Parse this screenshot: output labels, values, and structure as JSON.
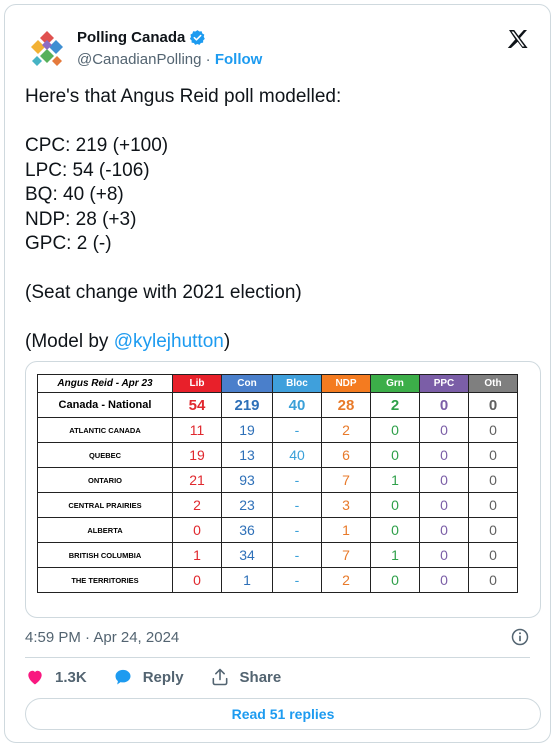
{
  "author": {
    "name": "Polling Canada",
    "handle": "@CanadianPolling",
    "separator": "·",
    "follow_label": "Follow"
  },
  "tweet": {
    "intro": "Here's that Angus Reid poll modelled:",
    "lines": [
      "CPC: 219 (+100)",
      "LPC: 54 (-106)",
      "BQ: 40 (+8)",
      "NDP: 28 (+3)",
      "GPC: 2 (-)"
    ],
    "note": "(Seat change with 2021 election)",
    "credit_prefix": "(Model by ",
    "credit_mention": "@kylejhutton",
    "credit_suffix": ")"
  },
  "seat_table": {
    "title": "Angus Reid - Apr 23",
    "parties": [
      {
        "label": "Lib",
        "header_color": "#e8202a",
        "text_color": "#e0282e"
      },
      {
        "label": "Con",
        "header_color": "#4a7fcb",
        "text_color": "#2e70b8"
      },
      {
        "label": "Bloc",
        "header_color": "#3fa0dc",
        "text_color": "#3aa0d8"
      },
      {
        "label": "NDP",
        "header_color": "#f47b20",
        "text_color": "#e87a2a"
      },
      {
        "label": "Grn",
        "header_color": "#3cae49",
        "text_color": "#2fa04a"
      },
      {
        "label": "PPC",
        "header_color": "#7b5ea7",
        "text_color": "#7b5ea7"
      },
      {
        "label": "Oth",
        "header_color": "#7f7f7f",
        "text_color": "#606060"
      }
    ],
    "rows": [
      {
        "region": "Canada - National",
        "values": [
          "54",
          "219",
          "40",
          "28",
          "2",
          "0",
          "0"
        ]
      },
      {
        "region": "ATLANTIC CANADA",
        "values": [
          "11",
          "19",
          "-",
          "2",
          "0",
          "0",
          "0"
        ]
      },
      {
        "region": "QUEBEC",
        "values": [
          "19",
          "13",
          "40",
          "6",
          "0",
          "0",
          "0"
        ]
      },
      {
        "region": "ONTARIO",
        "values": [
          "21",
          "93",
          "-",
          "7",
          "1",
          "0",
          "0"
        ]
      },
      {
        "region": "CENTRAL PRAIRIES",
        "values": [
          "2",
          "23",
          "-",
          "3",
          "0",
          "0",
          "0"
        ]
      },
      {
        "region": "ALBERTA",
        "values": [
          "0",
          "36",
          "-",
          "1",
          "0",
          "0",
          "0"
        ]
      },
      {
        "region": "BRITISH COLUMBIA",
        "values": [
          "1",
          "34",
          "-",
          "7",
          "1",
          "0",
          "0"
        ]
      },
      {
        "region": "THE TERRITORIES",
        "values": [
          "0",
          "1",
          "-",
          "2",
          "0",
          "0",
          "0"
        ]
      }
    ]
  },
  "timestamp": "4:59 PM · Apr 24, 2024",
  "actions": {
    "likes": "1.3K",
    "reply_label": "Reply",
    "share_label": "Share"
  },
  "read_replies_label": "Read 51 replies",
  "icons": {
    "verified": "verified-badge-icon",
    "x_logo": "x-logo-icon",
    "info": "info-icon",
    "like": "heart-icon",
    "reply": "speech-bubble-icon",
    "share": "share-upload-icon"
  },
  "colors": {
    "accent": "#1d9bf0",
    "like": "#f91880",
    "muted": "#536471"
  }
}
